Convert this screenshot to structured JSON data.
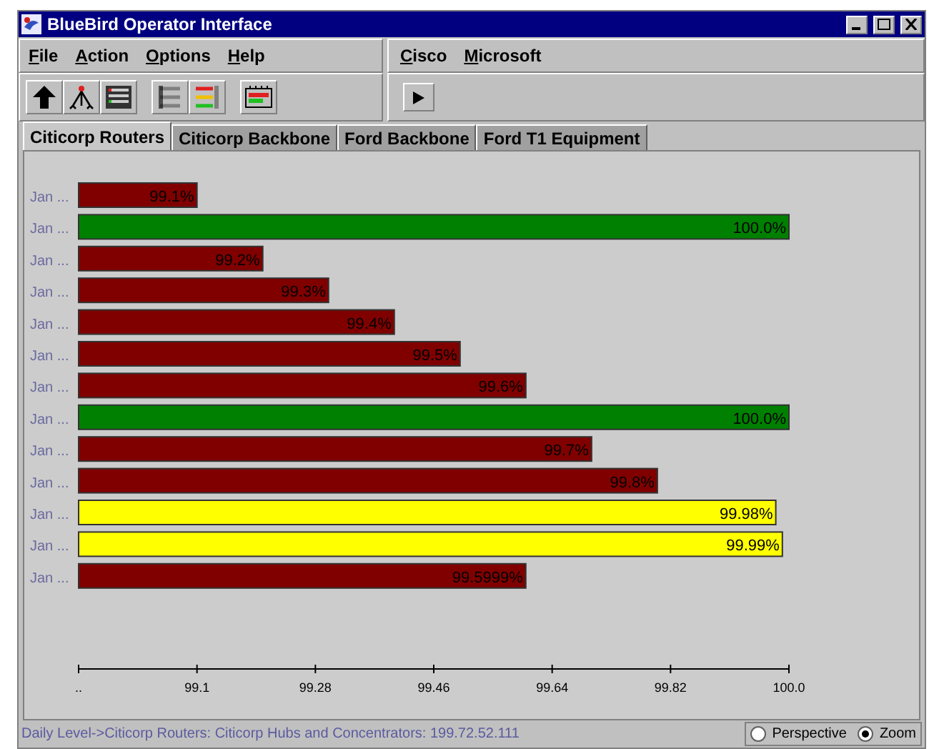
{
  "window": {
    "title": "BlueBird Operator Interface"
  },
  "menus_left": [
    "File",
    "Action",
    "Options",
    "Help"
  ],
  "menus_right": [
    "Cisco",
    "Microsoft"
  ],
  "tabs": [
    {
      "label": "Citicorp Routers",
      "selected": true
    },
    {
      "label": "Citicorp Backbone",
      "selected": false
    },
    {
      "label": "Ford Backbone",
      "selected": false
    },
    {
      "label": "Ford T1 Equipment",
      "selected": false
    }
  ],
  "chart": {
    "chart_data": {
      "type": "bar",
      "orientation": "horizontal",
      "categories": [
        "Jan ...",
        "Jan ...",
        "Jan ...",
        "Jan ...",
        "Jan ...",
        "Jan ...",
        "Jan ...",
        "Jan ...",
        "Jan ...",
        "Jan ...",
        "Jan ...",
        "Jan ...",
        "Jan ..."
      ],
      "series": [
        {
          "color": "#800000",
          "values": [
            99.1,
            null,
            99.2,
            99.3,
            99.4,
            99.5,
            99.6,
            null,
            99.7,
            99.8,
            null,
            null,
            99.5999
          ]
        },
        {
          "color": "#008000",
          "values": [
            null,
            100.0,
            null,
            null,
            null,
            null,
            null,
            100.0,
            null,
            null,
            null,
            null,
            null
          ]
        },
        {
          "color": "#ffff00",
          "values": [
            null,
            null,
            null,
            null,
            null,
            null,
            null,
            null,
            null,
            null,
            99.98,
            99.99,
            null
          ]
        }
      ],
      "value_labels": [
        "99.1%",
        "100.0%",
        "99.2%",
        "99.3%",
        "99.4%",
        "99.5%",
        "99.6%",
        "100.0%",
        "99.7%",
        "99.8%",
        "99.98%",
        "99.99%",
        "99.5999%"
      ],
      "xlim": [
        98.92,
        100
      ],
      "xticks": [
        {
          "value": 98.92,
          "label": ".."
        },
        {
          "value": 99.1,
          "label": "99.1"
        },
        {
          "value": 99.28,
          "label": "99.28"
        },
        {
          "value": 99.46,
          "label": "99.46"
        },
        {
          "value": 99.64,
          "label": "99.64"
        },
        {
          "value": 99.82,
          "label": "99.82"
        },
        {
          "value": 100,
          "label": "100.0"
        }
      ]
    }
  },
  "status_bar": {
    "text": "Daily Level->Citicorp Routers: Citicorp Hubs and Concentrators: 199.72.52.111"
  },
  "view_options": [
    {
      "label": "Perspective",
      "selected": false
    },
    {
      "label": "Zoom",
      "selected": true
    }
  ]
}
